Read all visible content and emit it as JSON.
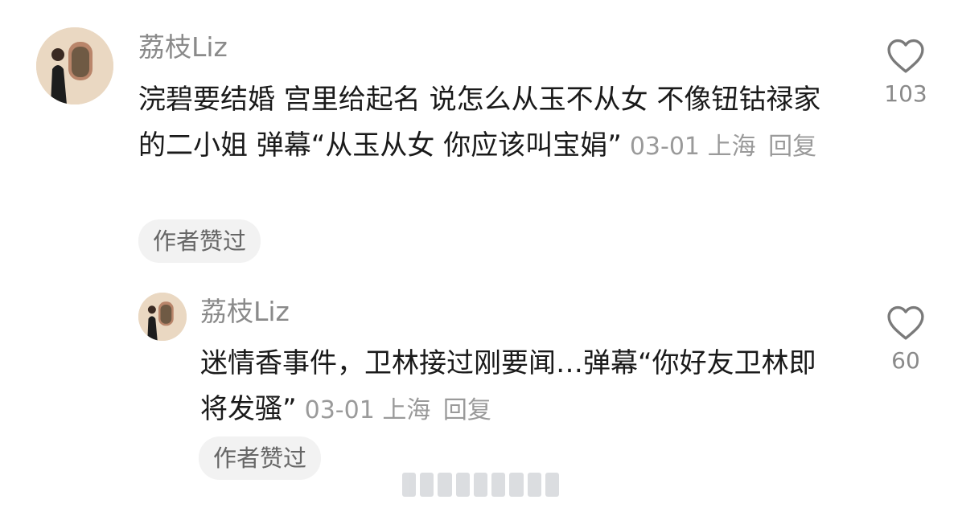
{
  "comments": [
    {
      "username": "荔枝Liz",
      "text": "浣碧要结婚 宫里给起名 说怎么从玉不从女 不像钮钴禄家的二小姐 弹幕“从玉从女 你应该叫宝娟”",
      "date": "03-01",
      "location": "上海",
      "reply_label": "回复",
      "badge": "作者赞过",
      "like_count": "103"
    },
    {
      "username": "荔枝Liz",
      "text": "迷情香事件，卫林接过刚要闻…弹幕“你好友卫林即将发骚”",
      "date": "03-01",
      "location": "上海",
      "reply_label": "回复",
      "badge": "作者赞过",
      "like_count": "60"
    }
  ],
  "colors": {
    "username": "#8a8a8a",
    "meta": "#9a9a9a",
    "badge_bg": "#f2f2f2",
    "heart": "#7a7a7a"
  },
  "icons": [
    "avatar",
    "heart-outline-icon"
  ]
}
